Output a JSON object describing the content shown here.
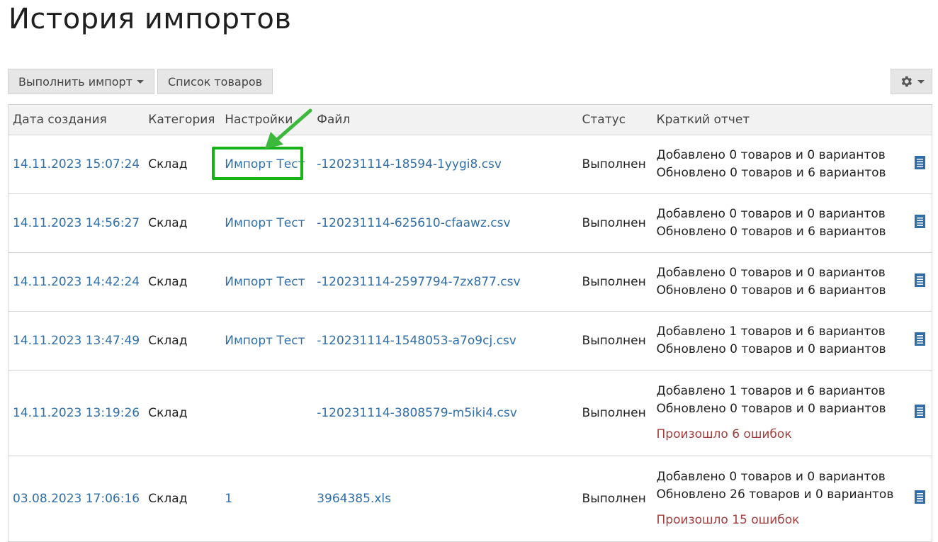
{
  "page": {
    "title": "История импортов"
  },
  "toolbar": {
    "import_label": "Выполнить импорт",
    "products_label": "Список товаров"
  },
  "table": {
    "headers": {
      "date": "Дата создания",
      "category": "Категория",
      "settings": "Настройки",
      "file": "Файл",
      "status": "Статус",
      "report": "Краткий отчет"
    },
    "rows": [
      {
        "date": "14.11.2023 15:07:24",
        "category": "Склад",
        "settings": "Импорт Тест",
        "file": "-120231114-18594-1yygi8.csv",
        "status": "Выполнен",
        "report": [
          "Добавлено 0 товаров и 0 вариантов",
          "Обновлено 0 товаров и 6 вариантов"
        ],
        "error": ""
      },
      {
        "date": "14.11.2023 14:56:27",
        "category": "Склад",
        "settings": "Импорт Тест",
        "file": "-120231114-625610-cfaawz.csv",
        "status": "Выполнен",
        "report": [
          "Добавлено 0 товаров и 0 вариантов",
          "Обновлено 0 товаров и 6 вариантов"
        ],
        "error": ""
      },
      {
        "date": "14.11.2023 14:42:24",
        "category": "Склад",
        "settings": "Импорт Тест",
        "file": "-120231114-2597794-7zx877.csv",
        "status": "Выполнен",
        "report": [
          "Добавлено 0 товаров и 0 вариантов",
          "Обновлено 0 товаров и 6 вариантов"
        ],
        "error": ""
      },
      {
        "date": "14.11.2023 13:47:49",
        "category": "Склад",
        "settings": "Импорт Тест",
        "file": "-120231114-1548053-a7o9cj.csv",
        "status": "Выполнен",
        "report": [
          "Добавлено 1 товаров и 6 вариантов",
          "Обновлено 0 товаров и 0 вариантов"
        ],
        "error": ""
      },
      {
        "date": "14.11.2023 13:19:26",
        "category": "Склад",
        "settings": "",
        "file": "-120231114-3808579-m5iki4.csv",
        "status": "Выполнен",
        "report": [
          "Добавлено 1 товаров и 6 вариантов",
          "Обновлено 0 товаров и 0 вариантов"
        ],
        "error": "Произошло 6 ошибок"
      },
      {
        "date": "03.08.2023 17:06:16",
        "category": "Склад",
        "settings": "1",
        "file": "3964385.xls",
        "status": "Выполнен",
        "report": [
          "Добавлено 0 товаров и 0 вариантов",
          "Обновлено 26 товаров и 0 вариантов"
        ],
        "error": "Произошло 15 ошибок"
      }
    ]
  },
  "icons": {
    "settings": "gear-icon",
    "dropdown": "chevron-down-icon",
    "details": "document-icon"
  },
  "colors": {
    "link": "#2f6ea8",
    "error": "#a33d3d",
    "highlight": "#17b317",
    "header_bg": "#f2f2f2",
    "button_bg": "#e6e6e6"
  }
}
